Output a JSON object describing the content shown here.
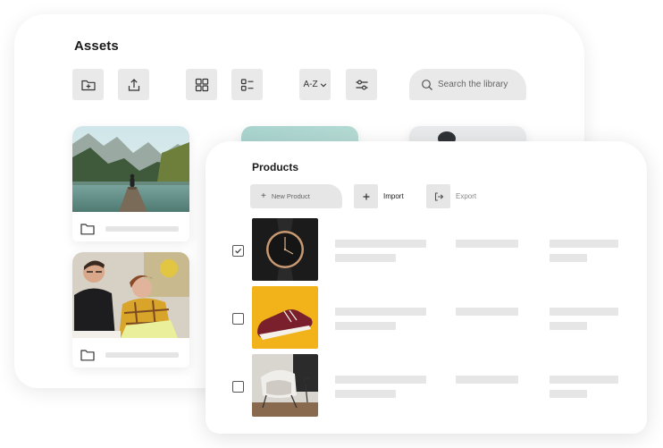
{
  "assets": {
    "title": "Assets",
    "toolbar": {
      "new_folder_icon": "folder-plus-icon",
      "upload_icon": "upload-icon",
      "grid_view_icon": "grid-view-icon",
      "list_view_icon": "list-view-icon",
      "sort_label": "A-Z",
      "filter_icon": "sliders-icon"
    },
    "search": {
      "placeholder": "Search the library"
    },
    "tiles": [
      {
        "image": "mountain-lake-photo"
      },
      {
        "image": "teal-photo"
      },
      {
        "image": "person-photo"
      },
      {
        "image": "people-laughing-photo"
      }
    ]
  },
  "products": {
    "title": "Products",
    "new_product_label": "New Product",
    "import_label": "Import",
    "export_label": "Export",
    "rows": [
      {
        "checked": true,
        "image": "watch-photo"
      },
      {
        "checked": false,
        "image": "sneaker-photo"
      },
      {
        "checked": false,
        "image": "chair-photo"
      }
    ]
  },
  "colors": {
    "placeholder_gray": "#e6e6e6",
    "button_gray": "#e9e9e9",
    "sneaker_bg": "#f2b21a",
    "sneaker_shoe": "#7a1f2c"
  }
}
